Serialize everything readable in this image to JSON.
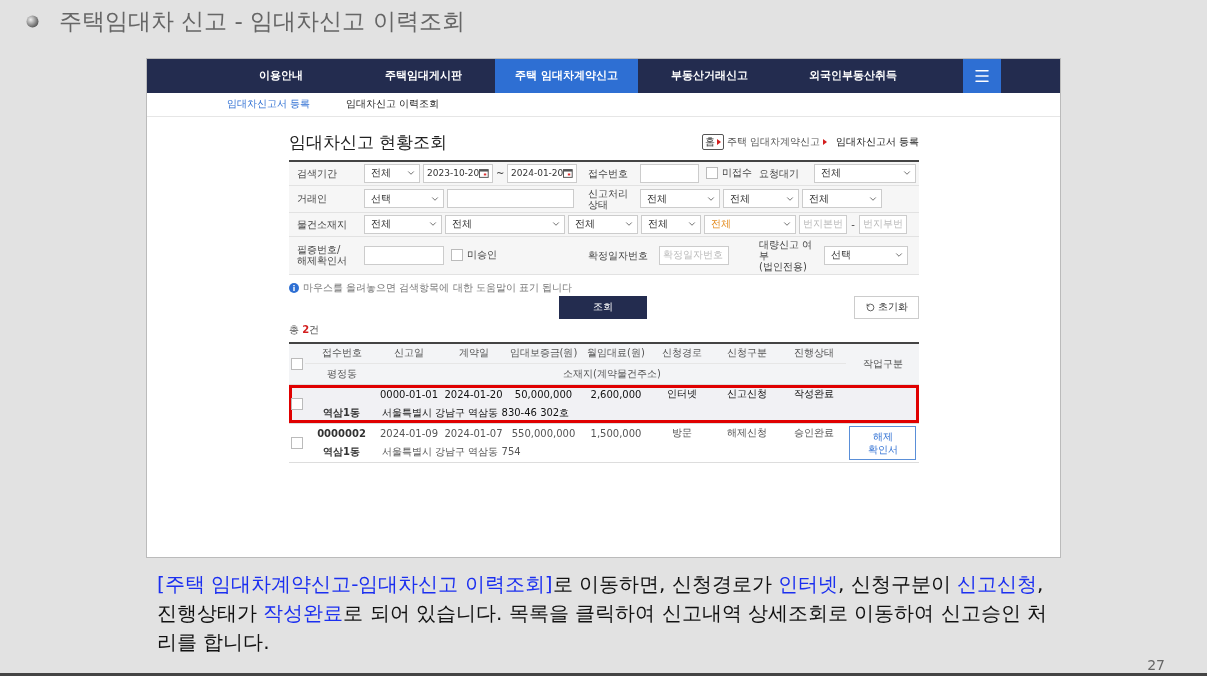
{
  "slide_title": "주택임대차 신고 - 임대차신고 이력조회",
  "nav": {
    "items": [
      {
        "label": "이용안내",
        "selected": false
      },
      {
        "label": "주택임대게시판",
        "selected": false
      },
      {
        "label": "주택 임대차계약신고",
        "selected": true
      },
      {
        "label": "부동산거래신고",
        "selected": false
      },
      {
        "label": "외국인부동산취득",
        "selected": false
      }
    ]
  },
  "subnav": [
    {
      "label": "임대차신고서 등록",
      "selected": true
    },
    {
      "label": "임대차신고 이력조회",
      "selected": false
    }
  ],
  "page_title": "임대차신고 현황조회",
  "breadcrumb": [
    "홈",
    "주택 임대차계약신고",
    "임대차신고서 등록"
  ],
  "form": {
    "rows": [
      {
        "fields": [
          {
            "label": "검색기간",
            "controls": [
              {
                "kind": "select",
                "value": "전체",
                "highlighted": false
              },
              {
                "kind": "date",
                "value": "2023-10-20"
              },
              {
                "kind": "sep",
                "text": "~"
              },
              {
                "kind": "date",
                "value": "2024-01-20"
              }
            ]
          },
          {
            "label": "접수번호",
            "controls": [
              {
                "kind": "input"
              },
              {
                "kind": "check",
                "text": "미접수",
                "checked": false
              }
            ]
          },
          {
            "label": "요청대기",
            "controls": [
              {
                "kind": "select",
                "value": "전체",
                "highlighted": false
              }
            ]
          }
        ]
      },
      {
        "fields": [
          {
            "label": "거래인",
            "controls": [
              {
                "kind": "select",
                "value": "선택",
                "highlighted": false
              },
              {
                "kind": "input"
              }
            ]
          },
          {
            "label": "신고처리\n상태",
            "controls": [
              {
                "kind": "select",
                "value": "전체",
                "highlighted": false
              },
              {
                "kind": "select",
                "value": "전체",
                "highlighted": false
              },
              {
                "kind": "select",
                "value": "전체",
                "highlighted": false
              }
            ]
          }
        ]
      },
      {
        "fields": [
          {
            "label": "물건소재지",
            "controls": [
              {
                "kind": "select",
                "value": "전체",
                "highlighted": false
              },
              {
                "kind": "select",
                "value": "전체",
                "highlighted": false
              },
              {
                "kind": "select",
                "value": "전체",
                "highlighted": false
              },
              {
                "kind": "select",
                "value": "전체",
                "highlighted": false
              },
              {
                "kind": "select",
                "value": "전체",
                "highlighted": true
              },
              {
                "kind": "input",
                "placeholder": "번지본번"
              },
              {
                "kind": "sep",
                "text": "-"
              },
              {
                "kind": "input",
                "placeholder": "번지부번"
              }
            ]
          }
        ]
      },
      {
        "fields": [
          {
            "label": "필증번호/\n해제확인서",
            "controls": [
              {
                "kind": "input"
              },
              {
                "kind": "check",
                "text": "미승인",
                "checked": false
              }
            ]
          },
          {
            "label": "확정일자번호",
            "controls": [
              {
                "kind": "input",
                "placeholder": "확정일자번호"
              }
            ]
          },
          {
            "label": "대량신고 여부\n(법인전용)",
            "controls": [
              {
                "kind": "select",
                "value": "선택",
                "highlighted": false
              }
            ]
          }
        ]
      }
    ]
  },
  "help_text": "마우스를 올려놓으면 검색항목에 대한 도움말이 표기 됩니다",
  "search_button": "조회",
  "reset_button": "초기화",
  "total": {
    "prefix": "총 ",
    "count": "2",
    "suffix": "건"
  },
  "table": {
    "header_checked": false,
    "columns": [
      "접수번호",
      "신고일",
      "계약일",
      "임대보증금(원)",
      "월임대료(원)",
      "신청경로",
      "신청구분",
      "진행상태",
      "작업구분"
    ],
    "subcolumns": [
      "평정동",
      "소재지(계약물건주소)"
    ],
    "rows": [
      {
        "selected": true,
        "outlined": true,
        "checked": false,
        "values": [
          "0000-01-01",
          "2024-01-20",
          "50,000,000",
          "2,600,000",
          "인터넷",
          "신고신청",
          "작성완료"
        ],
        "dong": "역삼1동",
        "address": "서울특별시 강남구 역삼동 830-46 302호"
      },
      {
        "selected": false,
        "outlined": false,
        "checked": false,
        "number": "0000002",
        "values": [
          "2024-01-09",
          "2024-01-07",
          "550,000,000",
          "1,500,000",
          "방문",
          "해제신청",
          "승인완료"
        ],
        "dong": "역삼1동",
        "address": "서울특별시 강남구 역삼동 754",
        "action": "해제\n확인서"
      }
    ]
  },
  "caption": [
    {
      "text": "[주택 임대차계약신고-임대차신고 이력조회]",
      "highlight": true
    },
    {
      "text": "로 이동하면, 신청경로가 ",
      "highlight": false
    },
    {
      "text": "인터넷",
      "highlight": true
    },
    {
      "text": ", 신청구분이 ",
      "highlight": false
    },
    {
      "text": "신고신청",
      "highlight": true
    },
    {
      "text": ", 진행상태가 ",
      "highlight": false
    },
    {
      "text": "작성완료",
      "highlight": true
    },
    {
      "text": "로 되어 있습니다. 목록을 클릭하여 신고내역 상세조회로 이동하여 신고승인 처리를 합니다.",
      "highlight": false
    }
  ],
  "page_number": "27"
}
